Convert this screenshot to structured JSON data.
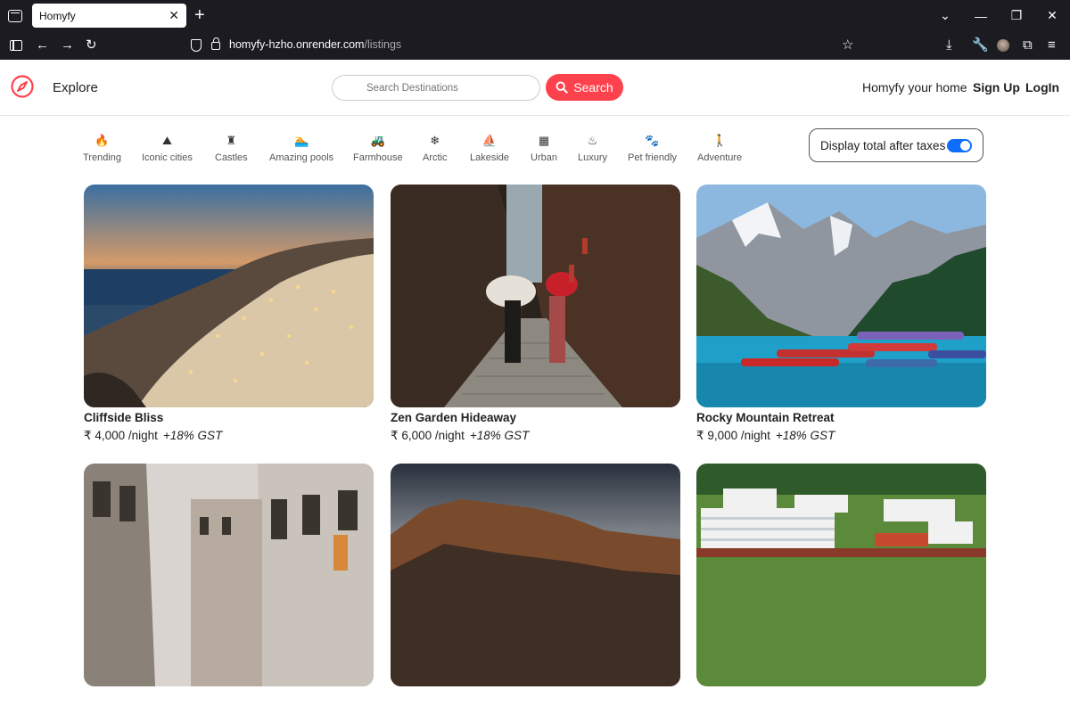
{
  "browser": {
    "tab_title": "Homyfy",
    "tab_close": "✕",
    "new_tab": "+",
    "url_host": "homyfy-hzho.onrender.com",
    "url_path": "/listings"
  },
  "header": {
    "explore_label": "Explore",
    "search_placeholder": "Search Destinations",
    "search_button": "Search",
    "host_label": "Homyfy your home",
    "signup_label": "Sign Up",
    "login_label": "LogIn",
    "brand_color": "#fe424d"
  },
  "filters": [
    {
      "label": "Trending",
      "icon": "fire-icon",
      "glyph": "🔥"
    },
    {
      "label": "Iconic cities",
      "icon": "mountain-city-icon",
      "glyph": "⛰"
    },
    {
      "label": "Castles",
      "icon": "chess-rook-icon",
      "glyph": "♜"
    },
    {
      "label": "Amazing pools",
      "icon": "person-swimming-icon",
      "glyph": "🏊"
    },
    {
      "label": "Farmhouse",
      "icon": "tractor-icon",
      "glyph": "🚜"
    },
    {
      "label": "Arctic",
      "icon": "snowflake-icon",
      "glyph": "❄"
    },
    {
      "label": "Lakeside",
      "icon": "sailboat-icon",
      "glyph": "⛵"
    },
    {
      "label": "Urban",
      "icon": "city-icon",
      "glyph": "▦"
    },
    {
      "label": "Luxury",
      "icon": "spa-icon",
      "glyph": "♨"
    },
    {
      "label": "Pet friendly",
      "icon": "paw-icon",
      "glyph": "🐾"
    },
    {
      "label": "Adventure",
      "icon": "person-hiking-icon",
      "glyph": "🚶"
    }
  ],
  "tax_toggle": {
    "label": "Display total after taxes",
    "checked": true,
    "accent": "#0d6efd"
  },
  "listings": [
    {
      "title": "Cliffside Bliss",
      "price": "₹ 4,000 /night",
      "gst": "+18% GST"
    },
    {
      "title": "Zen Garden Hideaway",
      "price": "₹ 6,000 /night",
      "gst": "+18% GST"
    },
    {
      "title": "Rocky Mountain Retreat",
      "price": "₹ 9,000 /night",
      "gst": "+18% GST"
    },
    {
      "title": "",
      "price": "",
      "gst": ""
    },
    {
      "title": "",
      "price": "",
      "gst": ""
    },
    {
      "title": "",
      "price": "",
      "gst": ""
    }
  ]
}
